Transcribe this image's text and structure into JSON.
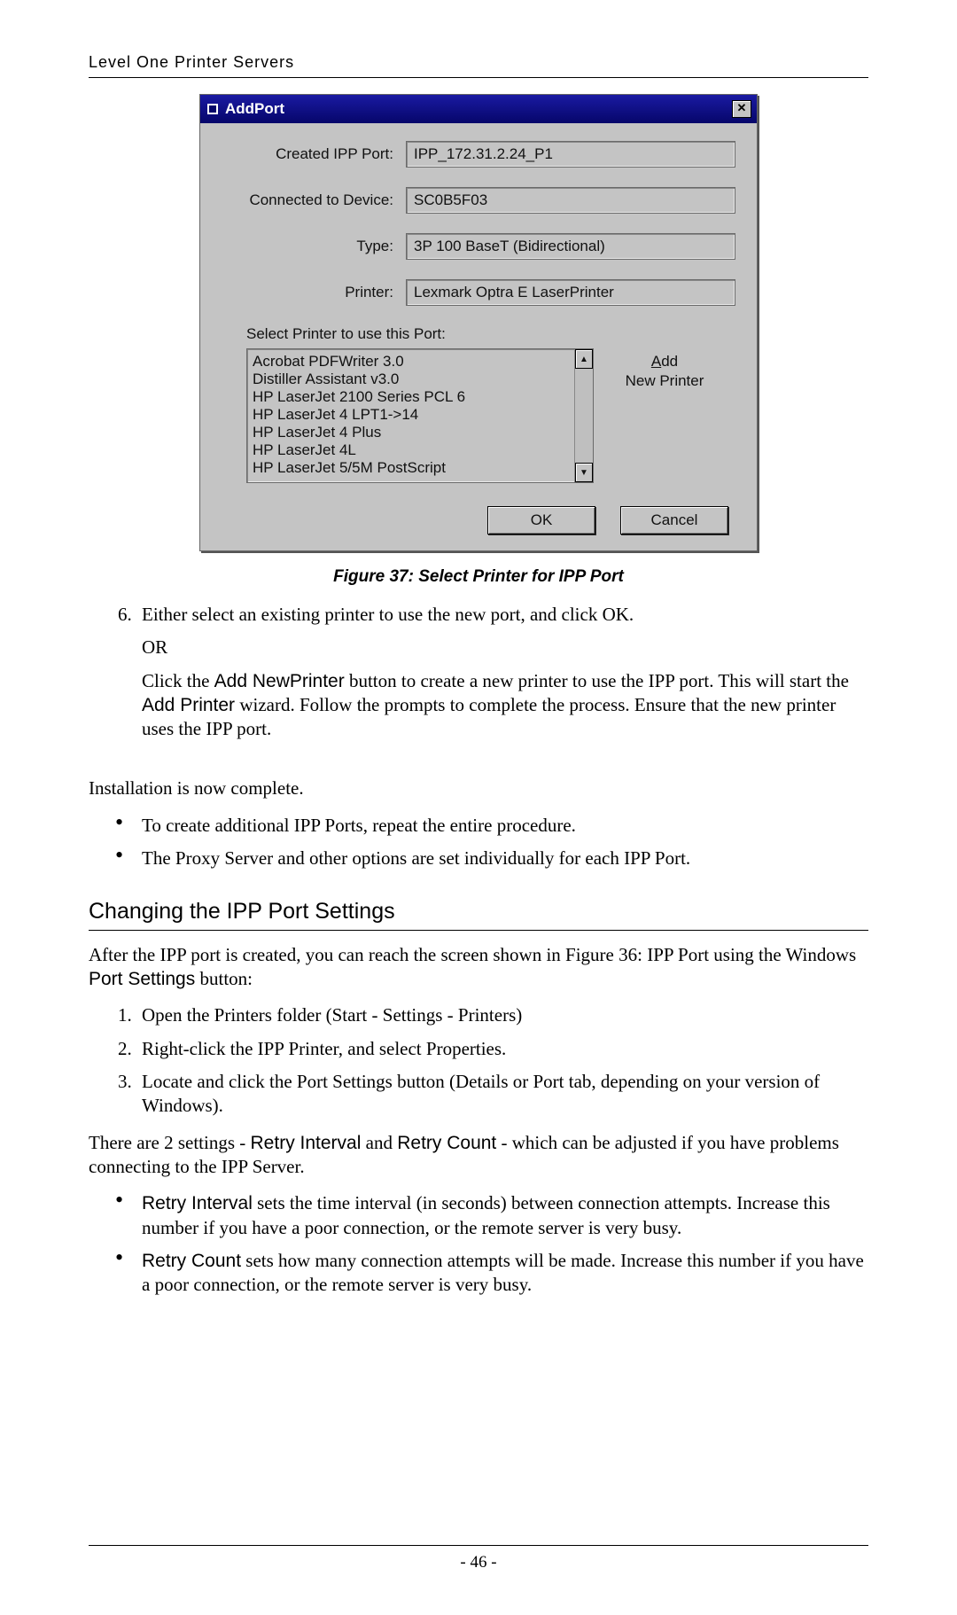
{
  "header": "Level One Printer Servers",
  "dialog": {
    "title": "AddPort",
    "close_glyph": "✕",
    "fields": {
      "created_label": "Created IPP Port:",
      "created_value": "IPP_172.31.2.24_P1",
      "device_label": "Connected to Device:",
      "device_value": "SC0B5F03",
      "type_label": "Type:",
      "type_value": "3P 100 BaseT (Bidirectional)",
      "printer_label": "Printer:",
      "printer_value": "Lexmark Optra E LaserPrinter"
    },
    "select_label": "Select Printer to use this Port:",
    "printers": [
      "Acrobat PDFWriter 3.0",
      "Distiller Assistant v3.0",
      "HP LaserJet 2100 Series PCL 6",
      "HP LaserJet 4 LPT1->14",
      "HP LaserJet 4 Plus",
      "HP LaserJet 4L",
      "HP LaserJet 5/5M PostScript"
    ],
    "scroll_up": "▲",
    "scroll_down": "▼",
    "addnew_underline": "A",
    "addnew_line1_rest": "dd",
    "addnew_line2": "New Printer",
    "ok": "OK",
    "cancel": "Cancel"
  },
  "caption": "Figure 37: Select Printer for IPP Port",
  "step6": {
    "num": "6.",
    "first": "Either select an existing printer to use the new port, and click OK.",
    "or": "OR",
    "second_pre": "Click the ",
    "second_btn1": "Add NewPrinter",
    "second_mid": " button to create a new printer to use the IPP port. This will start the ",
    "second_btn2": "Add Printer",
    "second_post": " wizard. Follow the prompts to complete the process. Ensure that the new printer uses the IPP port."
  },
  "install_done": "Installation is now complete.",
  "install_bullets": [
    "To create additional IPP Ports, repeat the entire procedure.",
    "The Proxy Server and other options are set individually for each IPP Port."
  ],
  "section_title": "Changing the IPP Port Settings",
  "after_para_pre": "After the IPP port is created, you can reach the screen shown in Figure 36: IPP Port using the Windows ",
  "after_para_btn": "Port Settings",
  "after_para_post": " button:",
  "steps": [
    "Open the Printers folder (Start - Settings - Printers)",
    "Right-click the IPP Printer, and select Properties.",
    "Locate and click the Port Settings button (Details or Port tab, depending on your version of Windows)."
  ],
  "settings_para_pre": "There are 2 settings - ",
  "settings_r1": "Retry Interval",
  "settings_mid": " and ",
  "settings_r2": "Retry Count",
  "settings_post": " - which can be adjusted if you have problems connecting to the IPP Server.",
  "retry_bullets": {
    "b1_bold": "Retry Interval",
    "b1_rest": " sets the time interval (in seconds) between connection attempts. Increase this number if you have a poor connection, or the remote server is very busy.",
    "b2_bold": "Retry Count",
    "b2_rest": " sets how many connection attempts will be made. Increase this number if you have a poor connection, or the remote server is very busy."
  },
  "page_number": "- 46 -"
}
